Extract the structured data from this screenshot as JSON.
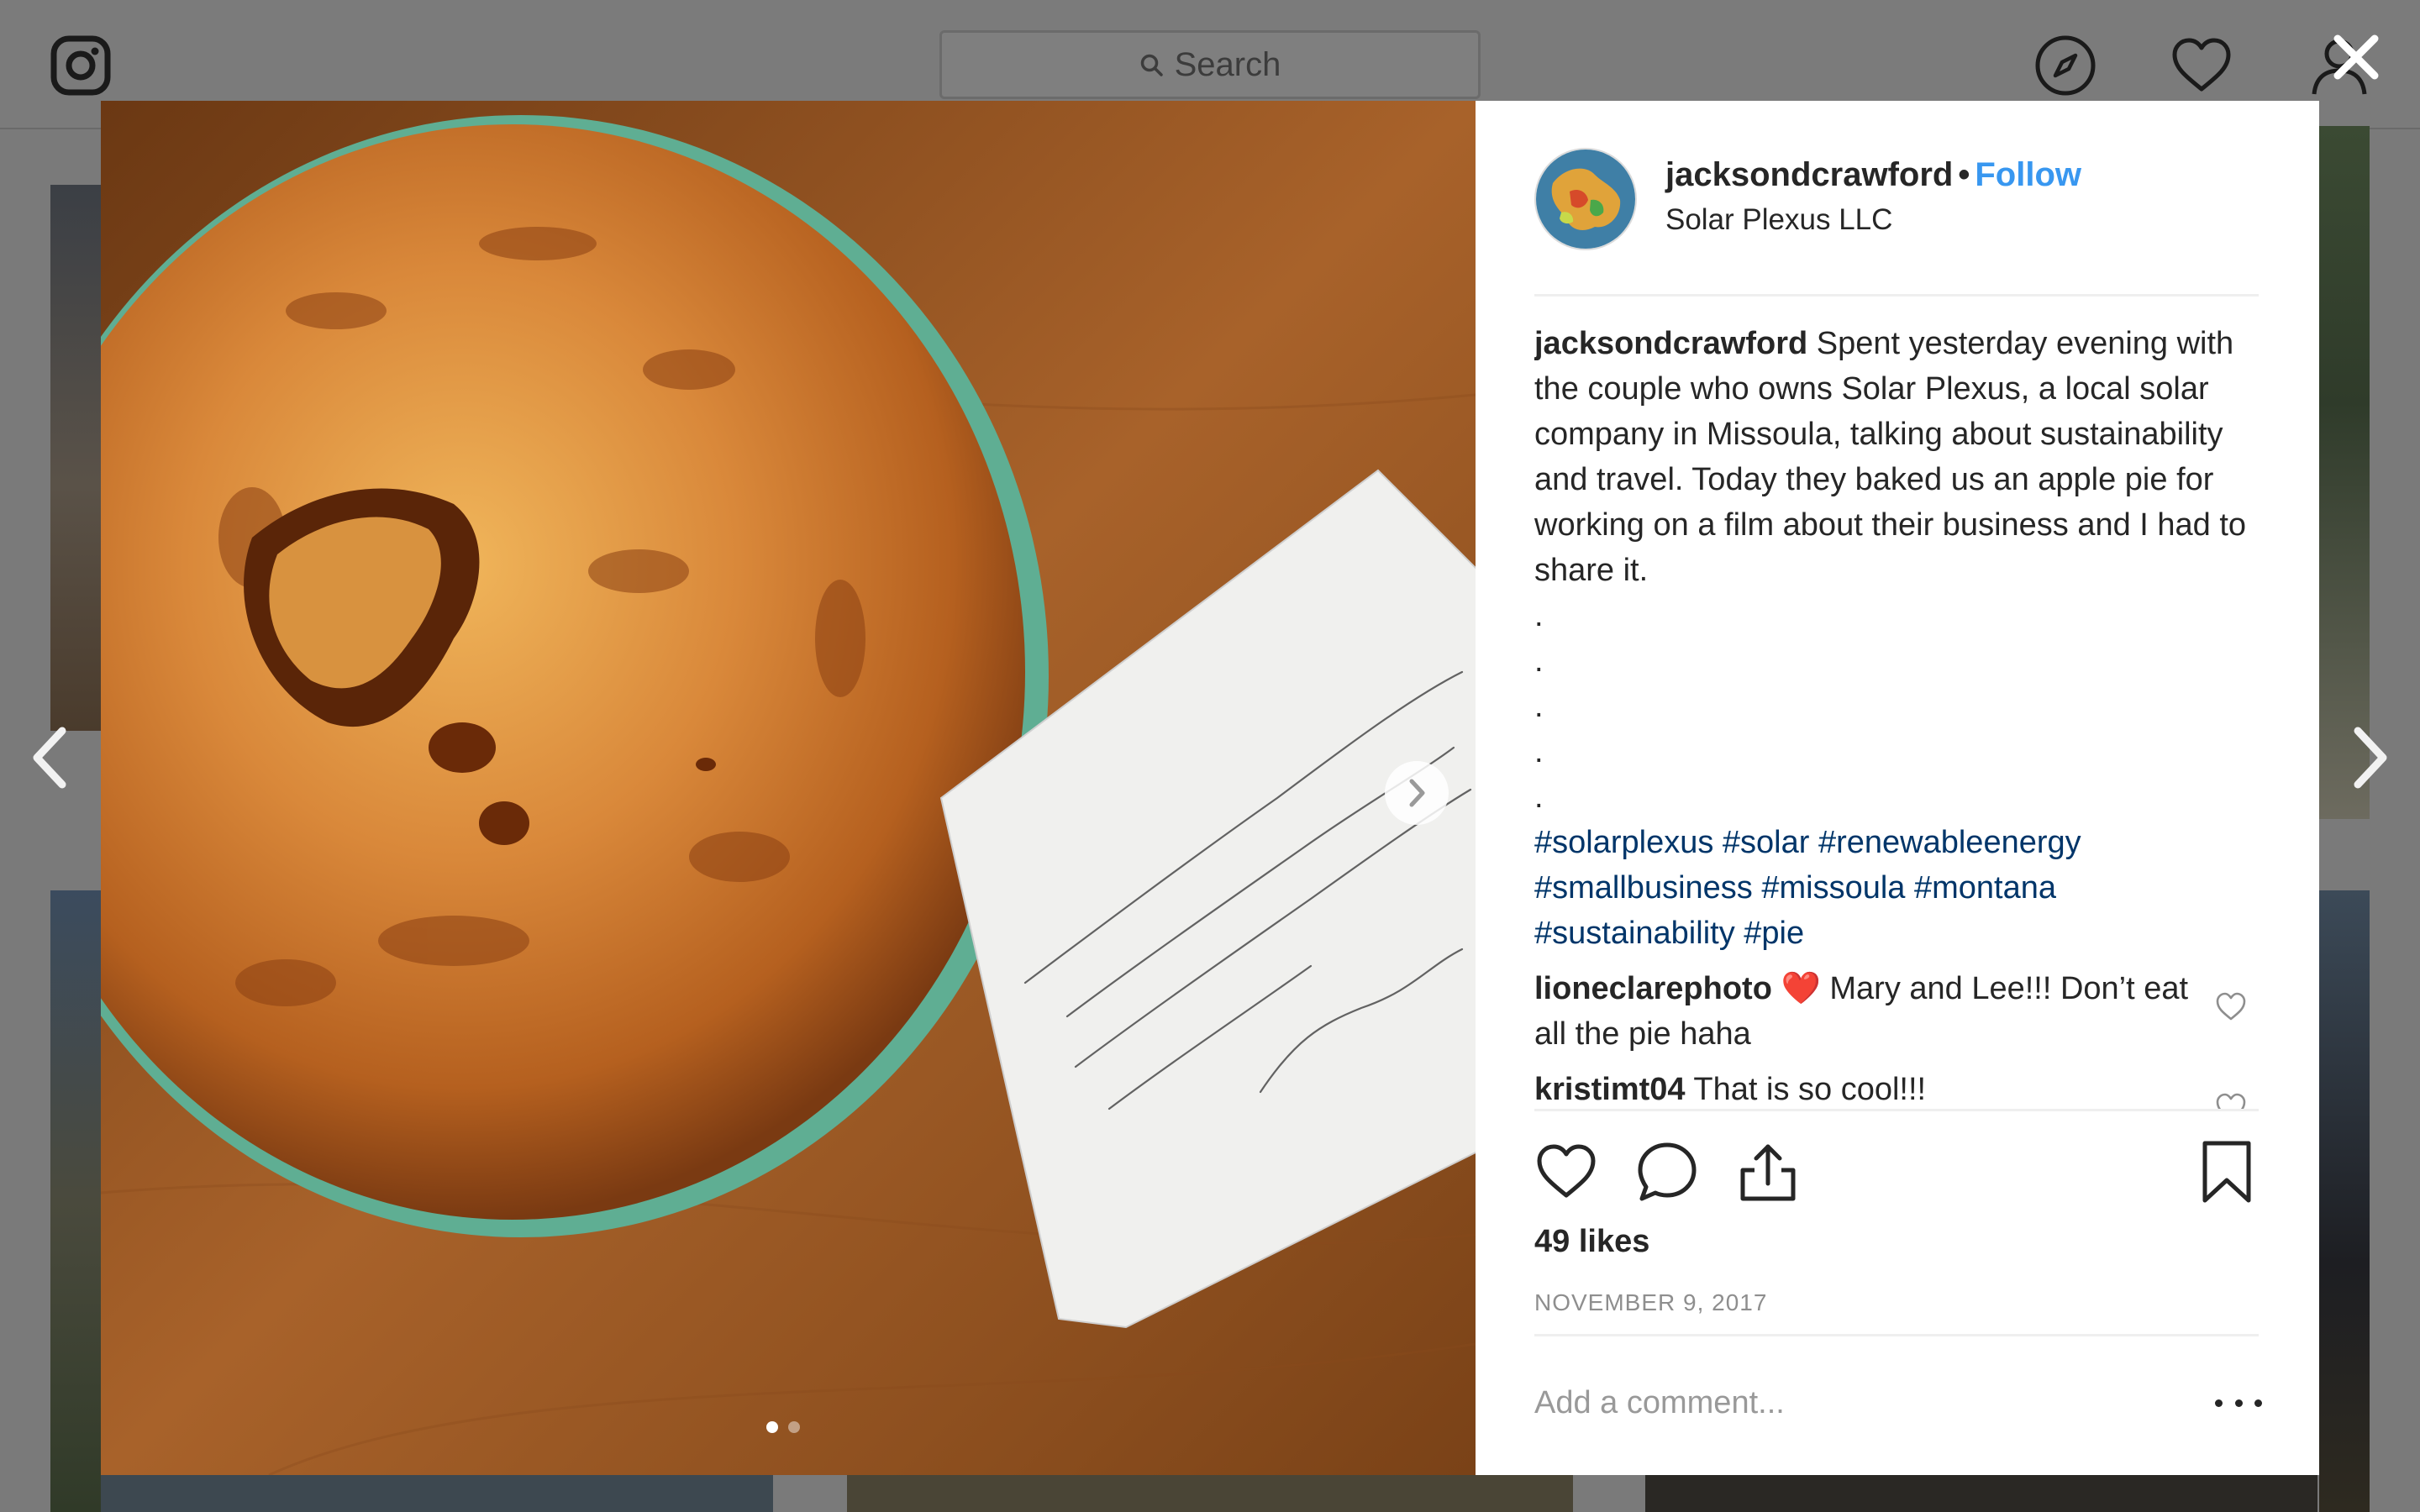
{
  "search": {
    "placeholder": "Search"
  },
  "post": {
    "username": "jacksondcrawford",
    "follow_label": "Follow",
    "separator": "•",
    "location": "Solar Plexus LLC",
    "caption_text": "Spent yesterday evening with the couple who owns Solar Plexus, a local solar company in Missoula, talking about sustainability and travel. Today they baked us an apple pie for working on a film about their business and I had to share it.",
    "caption_dots": [
      ".",
      ".",
      ".",
      ".",
      "."
    ],
    "hashtags": [
      "#solarplexus",
      "#solar",
      "#renewableenergy",
      "#smallbusiness",
      "#missoula",
      "#montana",
      "#sustainability",
      "#pie"
    ],
    "likes": "49 likes",
    "date": "NOVEMBER 9, 2017",
    "comment_placeholder": "Add a comment...",
    "media_pages": 2,
    "media_active_page": 1
  },
  "comments": [
    {
      "username": "lioneclarephoto",
      "emoji": "❤️",
      "text": "Mary and Lee!!! Don’t eat all the pie haha"
    },
    {
      "username": "kristimt04",
      "text": "That is so cool!!!"
    }
  ],
  "note": {
    "lines": [
      "You can just drop the pie plate off",
      "at the store next week sometime.",
      "It's so good to know will be leaving",
      "the planet in good hands!",
      "Mary & Lee"
    ]
  },
  "colors": {
    "accent": "#3897f0",
    "hashtag": "#003569",
    "meta": "#8e8e8e",
    "heart": "#ed4956"
  }
}
